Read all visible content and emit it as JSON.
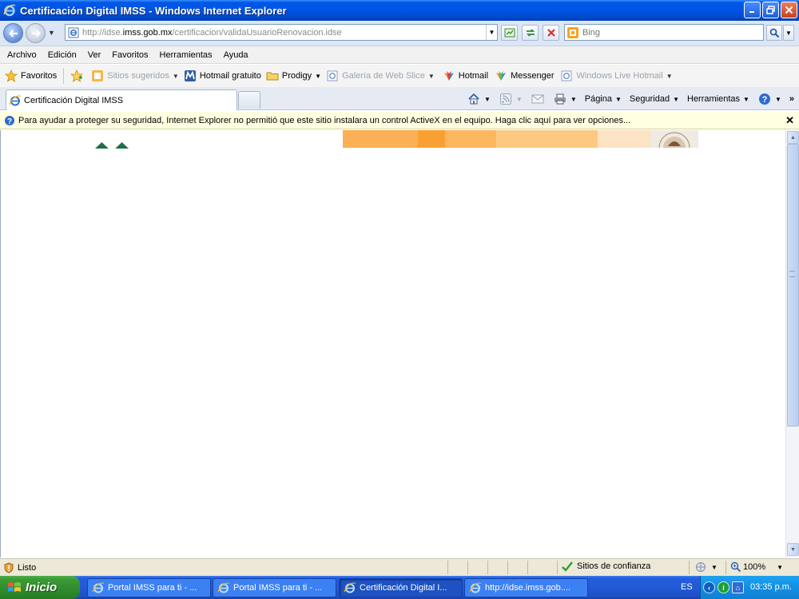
{
  "window": {
    "title": "Certificación Digital IMSS - Windows Internet Explorer"
  },
  "addressbar": {
    "url_prefix": "http://idse.",
    "url_domain": "imss.gob.mx",
    "url_path": "/certificacion/validaUsuarioRenovacion.idse"
  },
  "search": {
    "placeholder": "Bing"
  },
  "menu": {
    "items": [
      "Archivo",
      "Edición",
      "Ver",
      "Favoritos",
      "Herramientas",
      "Ayuda"
    ]
  },
  "favorites": {
    "favoritos_label": "Favoritos",
    "sitios_sugeridos": "Sitios sugeridos",
    "hotmail_gratuito": "Hotmail gratuito",
    "prodigy": "Prodigy",
    "galeria": "Galería de Web Slice",
    "hotmail": "Hotmail",
    "messenger": "Messenger",
    "windows_live_hotmail": "Windows Live Hotmail"
  },
  "tabs": {
    "active_tab": "Certificación Digital IMSS"
  },
  "commandbar": {
    "pagina": "Página",
    "seguridad": "Seguridad",
    "herramientas": "Herramientas"
  },
  "infobar": {
    "message": "Para ayudar a proteger su seguridad, Internet Explorer no permitió que este sitio instalara un control ActiveX en el equipo. Haga clic aquí para ver opciones..."
  },
  "content": {
    "banner_colors": [
      "#fbb055",
      "#f9a033",
      "#fcb75f",
      "#fdc982",
      "#fde3c3"
    ]
  },
  "statusbar": {
    "status": "Listo",
    "zone": "Sitios de confianza",
    "zoom": "100%"
  },
  "taskbar": {
    "start_label": "Inicio",
    "tasks": [
      "Portal IMSS para ti - ...",
      "Portal IMSS para ti - ...",
      "Certificación Digital I...",
      "http://idse.imss.gob...."
    ],
    "language": "ES",
    "clock": "03:35 p.m."
  }
}
